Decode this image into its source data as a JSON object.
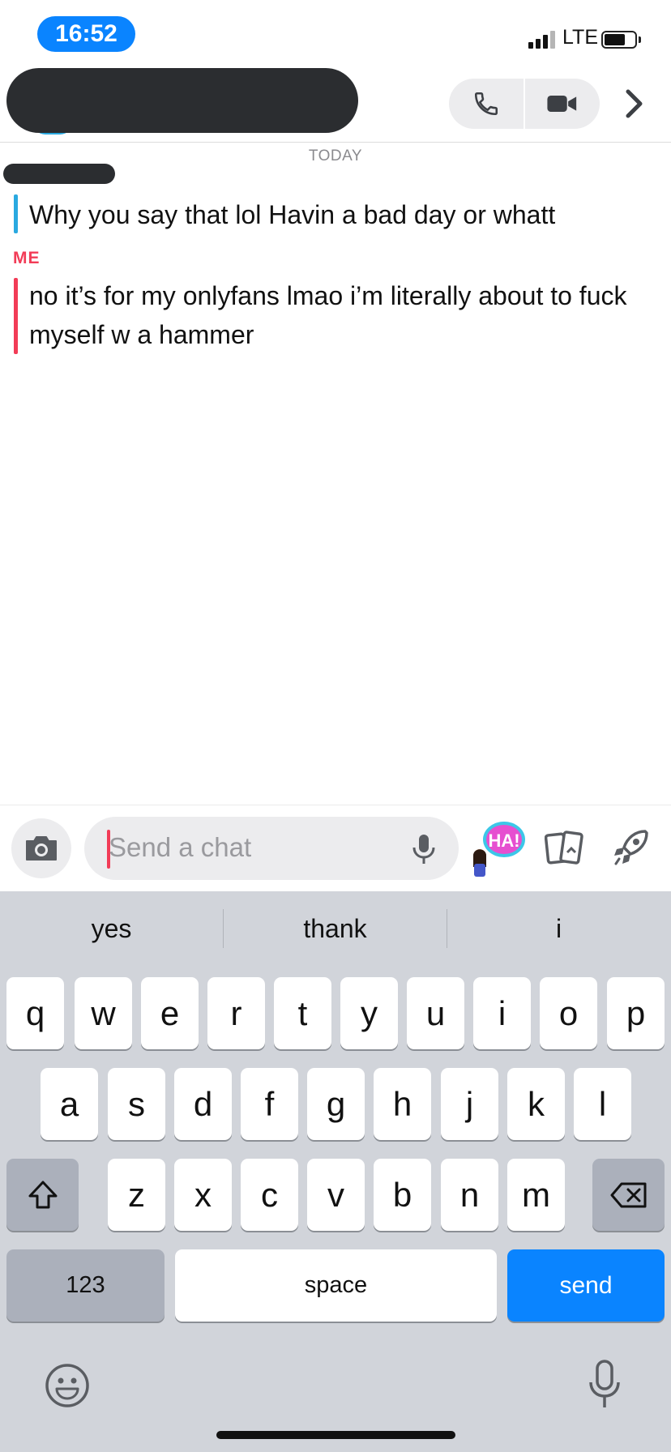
{
  "status_bar": {
    "time": "16:52",
    "network": "LTE"
  },
  "header": {
    "actions": [
      "phone-icon",
      "video-icon",
      "chevron-right-icon"
    ]
  },
  "chat": {
    "date_divider": "TODAY",
    "messages": [
      {
        "sender_redacted": true,
        "text": "Why you say that lol Havin a bad day or whatt",
        "color": "#2aa9e0"
      },
      {
        "sender": "ME",
        "text": "no it’s for my onlyfans lmao i’m literally about to fuck myself w a hammer",
        "color": "#f23c57"
      }
    ]
  },
  "composer": {
    "placeholder": "Send a chat",
    "bitmoji_text": "HA!"
  },
  "keyboard": {
    "suggestions": [
      "yes",
      "thank",
      "i"
    ],
    "row1": [
      "q",
      "w",
      "e",
      "r",
      "t",
      "y",
      "u",
      "i",
      "o",
      "p"
    ],
    "row2": [
      "a",
      "s",
      "d",
      "f",
      "g",
      "h",
      "j",
      "k",
      "l"
    ],
    "row3": [
      "z",
      "x",
      "c",
      "v",
      "b",
      "n",
      "m"
    ],
    "numbers_label": "123",
    "space_label": "space",
    "send_label": "send"
  },
  "colors": {
    "accent_blue": "#0a84ff",
    "me_red": "#f23c57",
    "friend_blue": "#2aa9e0"
  }
}
